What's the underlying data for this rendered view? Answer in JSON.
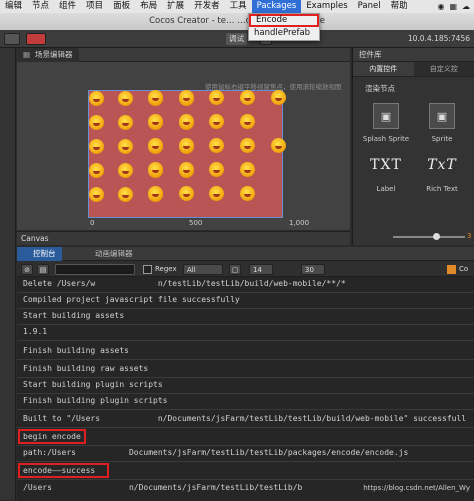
{
  "menubar": {
    "items": [
      "编辑",
      "节点",
      "组件",
      "项目",
      "面板",
      "布局",
      "扩展",
      "开发者",
      "工具",
      "Packages",
      "Examples",
      "Panel",
      "帮助"
    ],
    "status_text": "\u0000"
  },
  "dropdown": {
    "items": [
      "Encode",
      "handlePrefab"
    ]
  },
  "title": "Cocos Creator - te… …cene/cutScene.fire",
  "toolbar": {
    "btn_text": "调试",
    "ip": "10.0.4.185:7456"
  },
  "scene": {
    "tab_label": "场景编辑器",
    "tip": "使用鼠标右键平移视窗焦点，使用滚轮缩放视图",
    "axis_labels": [
      "0",
      "500",
      "1,000"
    ],
    "y_axis_label": "0"
  },
  "canvas_label": "Canvas",
  "right_panel": {
    "title": "控件库",
    "tabs": [
      "内置控件",
      "自定义控"
    ],
    "section": "渲染节点",
    "controls": [
      {
        "label": "Splash Sprite",
        "icon": "splash-sprite-icon"
      },
      {
        "label": "Sprite",
        "icon": "sprite-icon"
      },
      {
        "label": "Label",
        "glyph": "TXT"
      },
      {
        "label": "Rich Text",
        "glyph": "TxT"
      }
    ],
    "slider_value": "3"
  },
  "console_tabs": {
    "console": "控制台",
    "animation": "动画编辑器"
  },
  "console_toolbar": {
    "regex_label": "Regex",
    "filter_value": "All",
    "font_size": "14",
    "line_count": "30",
    "co_label": "Co"
  },
  "console": {
    "lines": [
      "Delete /Users/w             n/testLib/testLib/build/web-mobile/**/*",
      "Compiled project javascript file successfully",
      "Start building assets",
      "1.9.1",
      "Finish building assets",
      "Finish building raw assets",
      "Start building plugin scripts",
      "Finish building plugin scripts",
      "Built to \"/Users            n/Documents/jsFarm/testLib/testLib/build/web-mobile\" successfull",
      "begin encode",
      "path:/Users           Documents/jsFarm/testLib/testLib/packages/encode/encode.js",
      "encode——success",
      "/Users                n/Documents/jsFarm/testLib/testLib/b"
    ],
    "watermark": "https://blog.csdn.net/Allen_Wy"
  }
}
